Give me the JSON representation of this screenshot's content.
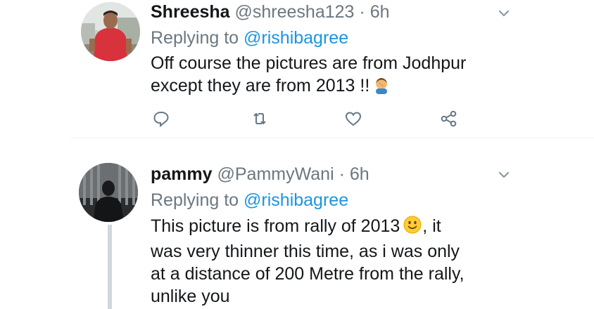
{
  "tweets": [
    {
      "display_name": "Shreesha",
      "handle": "@shreesha123",
      "separator": "·",
      "time": "6h",
      "replying_prefix": "Replying to",
      "replying_to": "@rishibagree",
      "body_lines": [
        "Off course the pictures are from Jodhpur",
        "except they are from 2013 !!"
      ],
      "body_emoji": "person-facepalming-emoji",
      "actions": [
        "reply-icon",
        "retweet-icon",
        "like-icon",
        "share-icon"
      ]
    },
    {
      "display_name": "pammy",
      "handle": "@PammyWani",
      "separator": "·",
      "time": "6h",
      "replying_prefix": "Replying to",
      "replying_to": "@rishibagree",
      "body_lines": [
        "This picture is from rally of 2013",
        ", it",
        "was very thinner this time, as i was only",
        "at a distance of 200 Metre from the rally,",
        "unlike you"
      ],
      "body_emoji": "slightly-smiling-face-emoji"
    }
  ],
  "colors": {
    "text": "#14171a",
    "secondary": "#6b7780",
    "link": "#1b95e0",
    "icon": "#657786",
    "thread_line": "#cfd9de"
  }
}
